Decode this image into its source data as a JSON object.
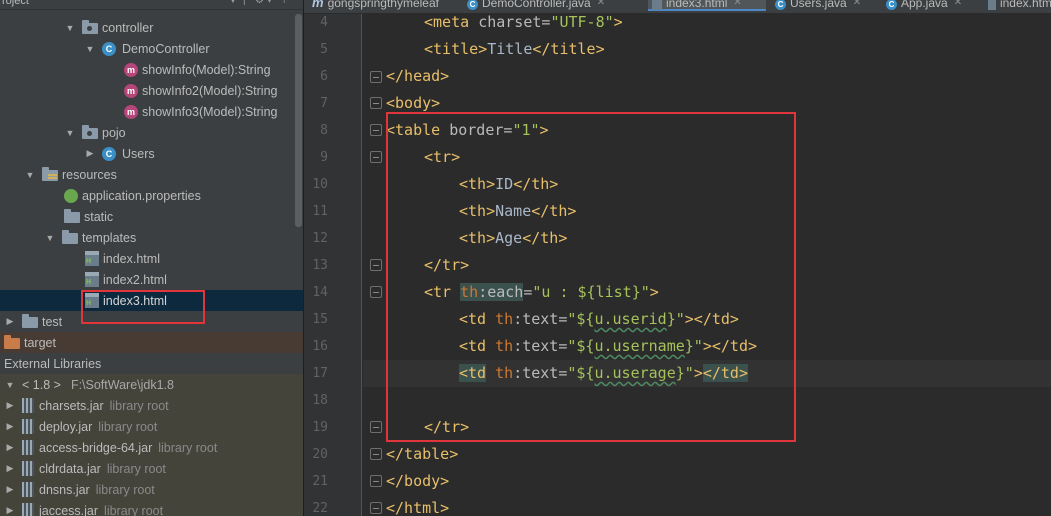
{
  "project_panel": {
    "title": "roject",
    "tree": [
      {
        "label": "controller",
        "icon": "package-folder-icon",
        "expanded": true
      },
      {
        "label": "DemoController",
        "icon": "class-icon",
        "expanded": true
      },
      {
        "label": "showInfo(Model):String",
        "icon": "method-icon"
      },
      {
        "label": "showInfo2(Model):String",
        "icon": "method-icon"
      },
      {
        "label": "showInfo3(Model):String",
        "icon": "method-icon"
      },
      {
        "label": "pojo",
        "icon": "package-folder-icon",
        "expanded": true
      },
      {
        "label": "Users",
        "icon": "class-icon",
        "expanded": false
      },
      {
        "label": "resources",
        "icon": "resources-folder-icon",
        "expanded": true
      },
      {
        "label": "application.properties",
        "icon": "properties-file-icon"
      },
      {
        "label": "static",
        "icon": "folder-icon"
      },
      {
        "label": "templates",
        "icon": "folder-icon",
        "expanded": true
      },
      {
        "label": "index.html",
        "icon": "html-file-icon"
      },
      {
        "label": "index2.html",
        "icon": "html-file-icon"
      },
      {
        "label": "index3.html",
        "icon": "html-file-icon",
        "selected": true
      },
      {
        "label": "test",
        "icon": "folder-icon",
        "expanded": false
      },
      {
        "label": "target",
        "icon": "excluded-folder-icon"
      },
      {
        "label": "External Libraries",
        "icon": "libraries-icon"
      },
      {
        "label": "< 1.8 >",
        "path": "F:\\SoftWare\\jdk1.8",
        "icon": "jdk-icon"
      },
      {
        "label": "charsets.jar",
        "suffix": "library root",
        "icon": "jar-icon"
      },
      {
        "label": "deploy.jar",
        "suffix": "library root",
        "icon": "jar-icon"
      },
      {
        "label": "access-bridge-64.jar",
        "suffix": "library root",
        "icon": "jar-icon"
      },
      {
        "label": "cldrdata.jar",
        "suffix": "library root",
        "icon": "jar-icon"
      },
      {
        "label": "dnsns.jar",
        "suffix": "library root",
        "icon": "jar-icon"
      },
      {
        "label": "jaccess.jar",
        "suffix": "library root",
        "icon": "jar-icon"
      }
    ]
  },
  "tabs": [
    {
      "label": "gongspringthymeleaf",
      "icon": "module-icon"
    },
    {
      "label": "DemoController.java",
      "icon": "class-icon"
    },
    {
      "label": "index3.html",
      "icon": "html-file-icon",
      "active": true
    },
    {
      "label": "Users.java",
      "icon": "class-icon"
    },
    {
      "label": "App.java",
      "icon": "class-icon"
    },
    {
      "label": "index.htm",
      "icon": "html-file-icon"
    }
  ],
  "line_numbers": [
    "4",
    "5",
    "6",
    "7",
    "8",
    "9",
    "10",
    "11",
    "12",
    "13",
    "14",
    "15",
    "16",
    "17",
    "18",
    "19",
    "20",
    "21",
    "22"
  ],
  "code": {
    "l4": {
      "tag": "<meta ",
      "attr": "charset",
      "eq": "=",
      "val": "\"UTF-8\"",
      "close": ">"
    },
    "l5": {
      "open": "<title>",
      "text": "Title",
      "close": "</title>"
    },
    "l6": "</head>",
    "l7": "<body>",
    "l8": {
      "tag": "<table ",
      "attr": "border",
      "eq": "=",
      "val": "\"1\"",
      "close": ">"
    },
    "l9": "<tr>",
    "l10": {
      "open": "<th>",
      "text": "ID",
      "close": "</th>"
    },
    "l11": {
      "open": "<th>",
      "text": "Name",
      "close": "</th>"
    },
    "l12": {
      "open": "<th>",
      "text": "Age",
      "close": "</th>"
    },
    "l13": "</tr>",
    "l14": {
      "tag": "<tr ",
      "ns": "th",
      "colon": ":",
      "attr": "each",
      "eq": "=",
      "q1": "\"",
      "expr": "u : ${list}",
      "q2": "\"",
      "close": ">"
    },
    "l15": {
      "tag": "<td ",
      "ns": "th",
      "colon": ":",
      "attr": "text",
      "eq": "=",
      "q1": "\"${",
      "expr_pre": "u.",
      "expr": "userid",
      "q2": "}\"",
      "close": "></td>"
    },
    "l16": {
      "tag": "<td ",
      "ns": "th",
      "colon": ":",
      "attr": "text",
      "eq": "=",
      "q1": "\"${",
      "expr_pre": "u.",
      "expr": "username",
      "q2": "}\"",
      "close": "></td>"
    },
    "l17": {
      "tag": "<td",
      "sp": " ",
      "ns": "th",
      "colon": ":",
      "attr": "text",
      "eq": "=",
      "q1": "\"${",
      "expr_pre": "u.",
      "expr": "userage",
      "q2": "}\"",
      "gt": ">",
      "close": "</td>"
    },
    "l19": "</tr>",
    "l20": "</table>",
    "l21": "</body>",
    "l22": "</html>"
  },
  "colors": {
    "highlight_box": "#e0353a",
    "tag": "#e8bf6a",
    "string": "#a5c25c",
    "namespace": "#cc7832"
  }
}
